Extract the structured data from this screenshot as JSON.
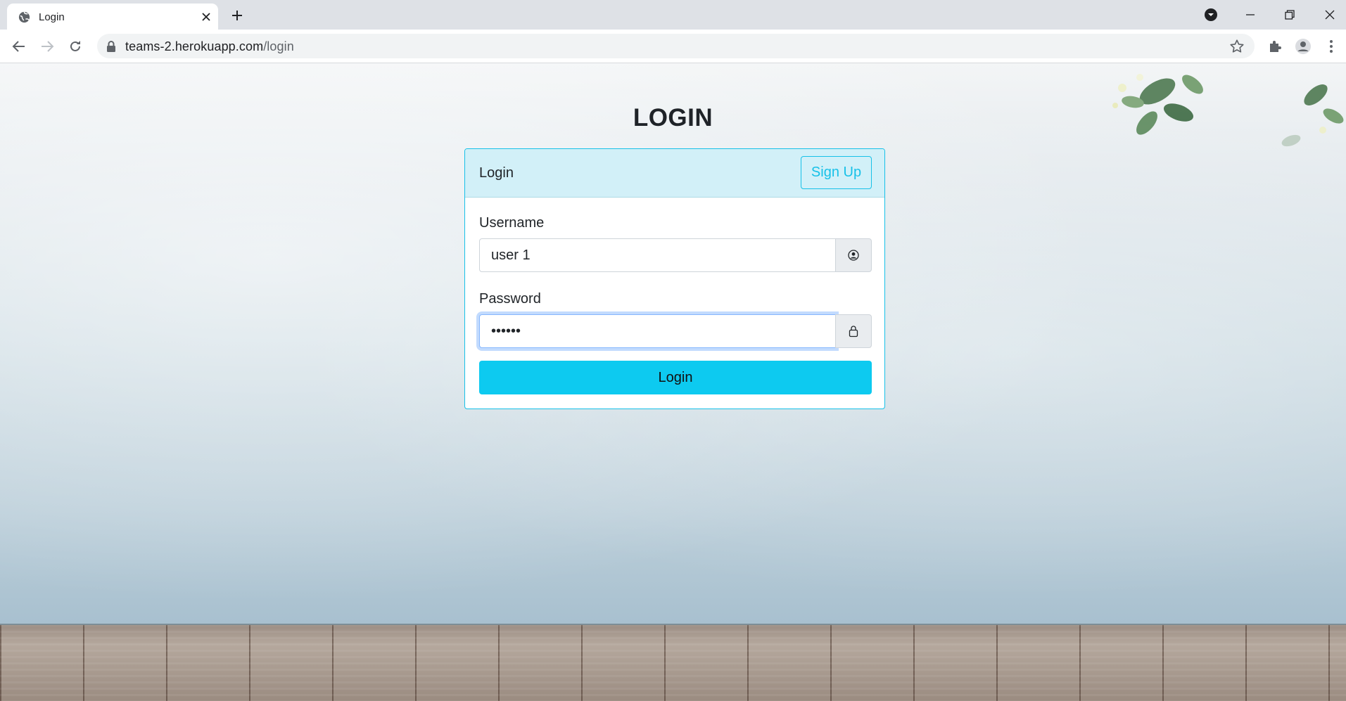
{
  "browser": {
    "tab_title": "Login",
    "url_host": "teams-2.herokuapp.com",
    "url_path": "/login"
  },
  "page": {
    "heading": "LOGIN"
  },
  "card": {
    "header_title": "Login",
    "signup_label": "Sign Up",
    "username_label": "Username",
    "username_value": "user 1",
    "password_label": "Password",
    "password_value": "••••••",
    "login_label": "Login"
  },
  "colors": {
    "accent": "#0dcaf0",
    "header_bg": "#d2f0f8",
    "border": "#17c1e8"
  },
  "icons": {
    "username_addon": "user-circle-icon",
    "password_addon": "lock-icon"
  }
}
